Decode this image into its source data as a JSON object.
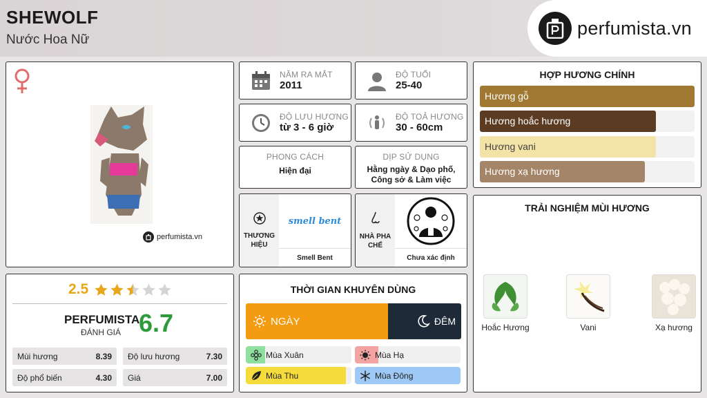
{
  "header": {
    "title": "SHEWOLF",
    "subtitle": "Nước Hoa Nữ",
    "brand": "perfumista.vn"
  },
  "product": {
    "gender_icon": "female-symbol-icon",
    "watermark": "perfumista.vn"
  },
  "stats": {
    "release": {
      "label": "NĂM RA MẮT",
      "value": "2011"
    },
    "age": {
      "label": "ĐỘ TUỔI",
      "value": "25-40"
    },
    "longevity": {
      "label": "ĐỘ LƯU HƯƠNG",
      "value": "từ 3 - 6 giờ"
    },
    "sillage": {
      "label": "ĐỘ TOẢ HƯƠNG",
      "value": "30 - 60cm"
    },
    "style": {
      "label": "PHONG CÁCH",
      "value": "Hiện đại"
    },
    "occasion": {
      "label": "DỊP SỬ DỤNG",
      "value": "Hằng ngày & Dạo phố, Công sở & Làm việc"
    },
    "brand": {
      "label": "THƯƠNG HIỆU",
      "logo_text": "smell bent",
      "name": "Smell Bent"
    },
    "perfumer": {
      "label": "NHÀ PHA CHẾ",
      "name": "Chưa xác định"
    }
  },
  "accords": {
    "title": "HỢP HƯƠNG CHÍNH",
    "items": [
      {
        "name": "Hương gỗ",
        "level": 1.0,
        "color": "#a07831",
        "text_color": "#ffffff"
      },
      {
        "name": "Hương hoắc hương",
        "level": 0.82,
        "color": "#5b3b22",
        "text_color": "#ffffff"
      },
      {
        "name": "Hương vani",
        "level": 0.82,
        "color": "#f3e3a6",
        "text_color": "#444444"
      },
      {
        "name": "Hương xạ hương",
        "level": 0.77,
        "color": "#a58568",
        "text_color": "#ffffff"
      }
    ]
  },
  "experience": {
    "title": "TRẢI NGHIỆM MÙI HƯƠNG",
    "notes": [
      {
        "name": "Hoắc Hương",
        "icon": "patchouli-leaf-icon"
      },
      {
        "name": "Vani",
        "icon": "vanilla-flower-icon"
      },
      {
        "name": "Xạ hương",
        "icon": "musk-icon"
      }
    ]
  },
  "rating": {
    "score": "2.5",
    "stars": 2.5,
    "brand_label": "PERFUMISTA",
    "sub_label": "ĐÁNH GIÁ",
    "overall": "6.7",
    "metrics": [
      {
        "name": "Mùi hương",
        "value": "8.39"
      },
      {
        "name": "Độ lưu hương",
        "value": "7.30"
      },
      {
        "name": "Độ phổ biến",
        "value": "4.30"
      },
      {
        "name": "Giá",
        "value": "7.00"
      }
    ]
  },
  "timing": {
    "title": "THỜI GIAN KHUYÊN DÙNG",
    "day_label": "NGÀY",
    "night_label": "ĐÊM",
    "day_share": 0.66,
    "day_color": "#f39c12",
    "night_color": "#1f2a38",
    "seasons": [
      {
        "name": "Mùa Xuân",
        "level": 0.18,
        "color": "#8fe0a0",
        "icon": "flower-icon"
      },
      {
        "name": "Mùa Hạ",
        "level": 0.22,
        "color": "#f4a3a3",
        "icon": "sun-icon"
      },
      {
        "name": "Mùa Thu",
        "level": 0.95,
        "color": "#f5dc3c",
        "icon": "leaf-icon"
      },
      {
        "name": "Mùa Đông",
        "level": 1.0,
        "color": "#9ec8f5",
        "icon": "snowflake-icon"
      }
    ]
  }
}
